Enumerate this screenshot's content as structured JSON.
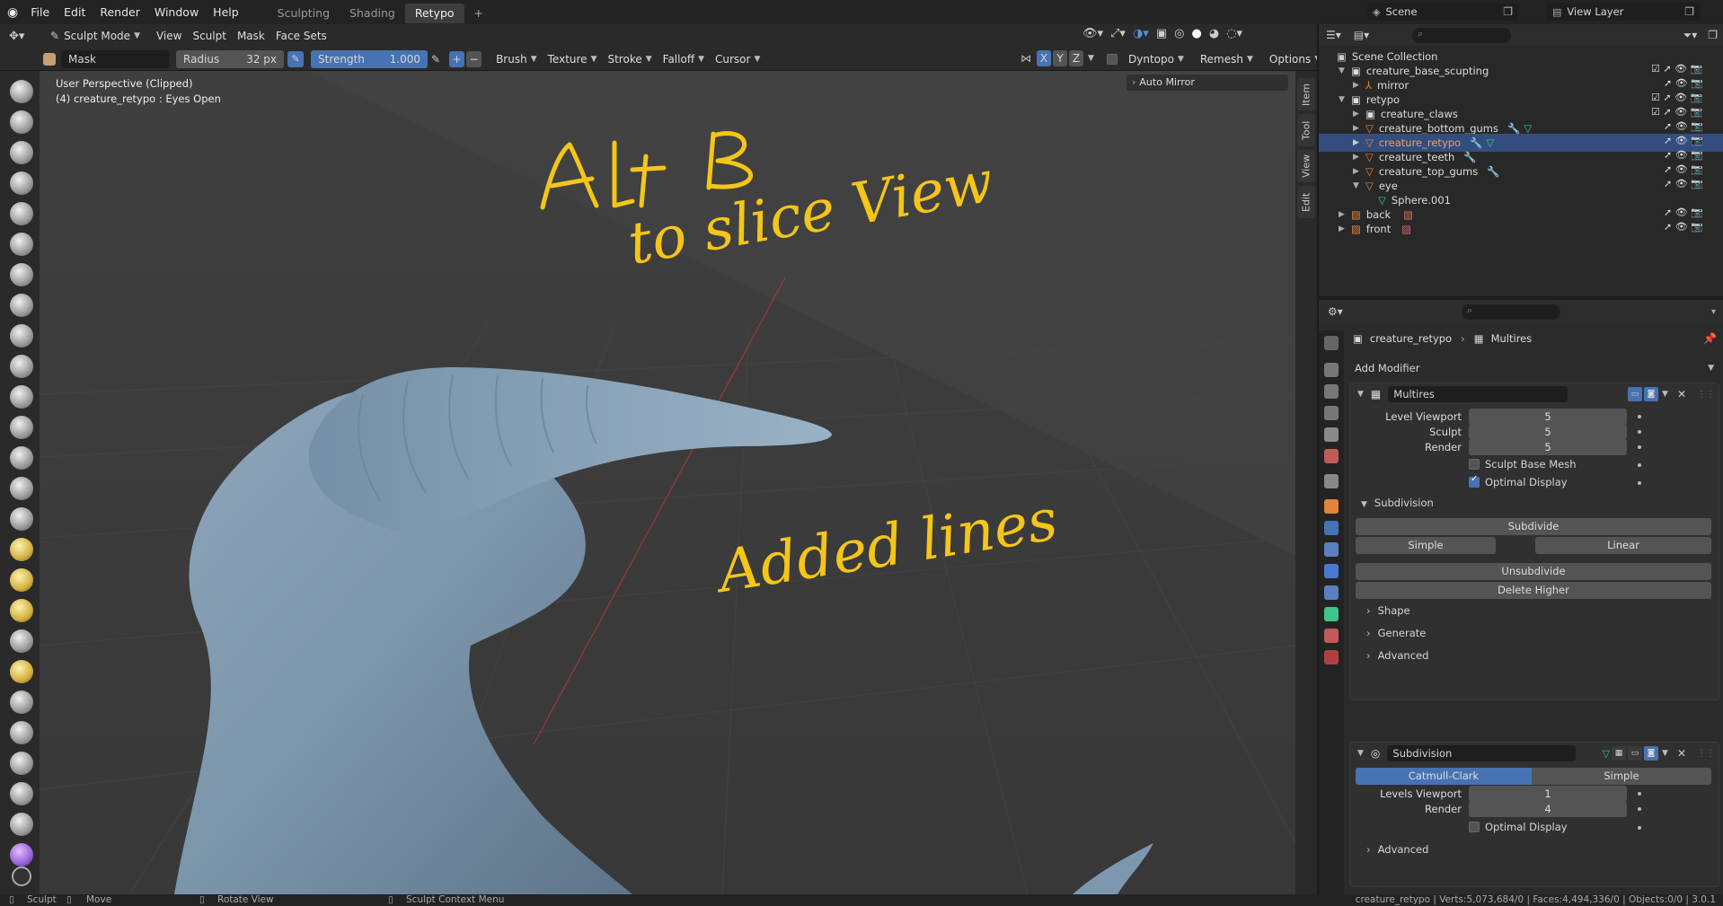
{
  "topbar": {
    "menus": [
      "File",
      "Edit",
      "Render",
      "Window",
      "Help"
    ],
    "workspace_tabs": [
      "Sculpting",
      "Shading",
      "Retypo"
    ],
    "active_tab": "Retypo",
    "add_tab": "+",
    "scene": "Scene",
    "view_layer": "View Layer"
  },
  "header": {
    "mode": "Sculpt Mode",
    "menus": [
      "View",
      "Sculpt",
      "Mask",
      "Face Sets"
    ]
  },
  "tool_settings": {
    "brush_name": "Mask",
    "radius_label": "Radius",
    "radius_value": "32 px",
    "strength_label": "Strength",
    "strength_value": "1.000",
    "plus": "+",
    "minus": "−",
    "dropdowns": [
      "Brush",
      "Texture",
      "Stroke",
      "Falloff",
      "Cursor"
    ],
    "axes": [
      "X",
      "Y",
      "Z"
    ],
    "dyntopo": "Dyntopo",
    "remesh": "Remesh",
    "options": "Options"
  },
  "viewport": {
    "perspective": "User Perspective (Clipped)",
    "object_info": "(4) creature_retypo : Eyes Open",
    "auto_mirror": "Auto Mirror",
    "annotation_line1": "Alt  B",
    "annotation_line2": "to  slice  View",
    "annotation_line3": "Added  lines",
    "side_tabs": [
      "Item",
      "Tool",
      "View",
      "Edit"
    ]
  },
  "outliner": {
    "root": "Scene Collection",
    "rows": [
      {
        "label": "creature_base_scupting",
        "indent": 1
      },
      {
        "label": "mirror",
        "indent": 2
      },
      {
        "label": "retypo",
        "indent": 1
      },
      {
        "label": "creature_claws",
        "indent": 2
      },
      {
        "label": "creature_bottom_gums",
        "indent": 2
      },
      {
        "label": "creature_retypo",
        "indent": 2
      },
      {
        "label": "creature_teeth",
        "indent": 2
      },
      {
        "label": "creature_top_gums",
        "indent": 2
      },
      {
        "label": "eye",
        "indent": 2
      },
      {
        "label": "Sphere.001",
        "indent": 3
      },
      {
        "label": "back",
        "indent": 1
      },
      {
        "label": "front",
        "indent": 1
      }
    ],
    "selected_index": 5
  },
  "properties": {
    "breadcrumb_object": "creature_retypo",
    "breadcrumb_modifier": "Multires",
    "add_modifier": "Add Modifier",
    "multires": {
      "name": "Multires",
      "level_viewport_label": "Level Viewport",
      "level_viewport": "5",
      "sculpt_label": "Sculpt",
      "sculpt": "5",
      "render_label": "Render",
      "render": "5",
      "sculpt_base_mesh": "Sculpt Base Mesh",
      "optimal_display": "Optimal Display",
      "subdivision_section": "Subdivision",
      "subdivide": "Subdivide",
      "simple": "Simple",
      "linear": "Linear",
      "unsubdivide": "Unsubdivide",
      "delete_higher": "Delete Higher",
      "shape": "Shape",
      "generate": "Generate",
      "advanced": "Advanced"
    },
    "subdivision": {
      "name": "Subdivision",
      "catmull_clark": "Catmull-Clark",
      "simple": "Simple",
      "levels_viewport_label": "Levels Viewport",
      "levels_viewport": "1",
      "render_label": "Render",
      "render": "4",
      "optimal_display": "Optimal Display",
      "advanced": "Advanced"
    }
  },
  "status_bar": {
    "sculpt": "Sculpt",
    "move": "Move",
    "rotate_view": "Rotate View",
    "context_menu": "Sculpt Context Menu",
    "stats": "creature_retypo | Verts:5,073,684/0 | Faces:4,494,336/0 | Objects:0/0 | 3.0.1"
  },
  "colors": {
    "accent": "#4772b3",
    "annotation": "#f5c518",
    "mesh": "#7d97ae"
  }
}
